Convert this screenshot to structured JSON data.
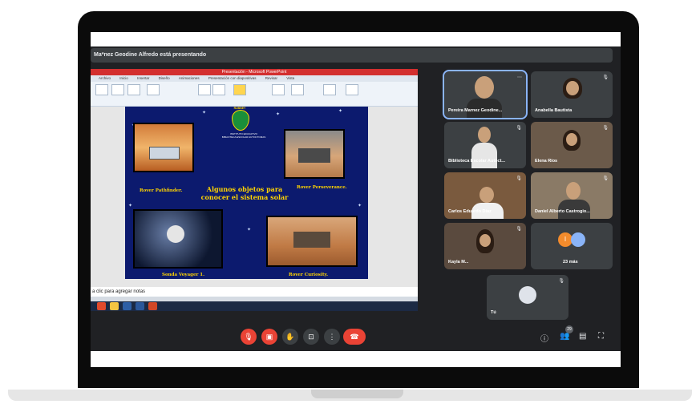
{
  "meeting": {
    "presenting_banner": "Ma*nez Geodine Alfredo está presentando"
  },
  "presentation": {
    "window_title": "Presentación - Microsoft PowerPoint",
    "ribbon_tabs": [
      "Archivo",
      "Inicio",
      "Insertar",
      "Diseño",
      "Animaciones",
      "Presentación con diapositivas",
      "Revisar",
      "Vista"
    ],
    "logo_text": "RUBBEY",
    "school_line1": "INSTITUTO EDUCATIVO",
    "school_line2": "BIBLIOTECA ESCOLAR AUTOCTOMAS",
    "caption_pathfinder": "Rover Pathfinder.",
    "caption_perseverance": "Rover Perseverance.",
    "center_line1": "Algunos objetos para",
    "center_line2": "conocer el sistema solar",
    "caption_voyager": "Sonda Voyager 1.",
    "caption_curiosity": "Rover Curiosity.",
    "notes_placeholder": "a clic para agregar notas"
  },
  "participants": [
    {
      "name": "Pereira Marnez Geodine...",
      "active": true
    },
    {
      "name": "Anabella Bautista"
    },
    {
      "name": "Biblioteca Escolar Autóct..."
    },
    {
      "name": "Elena Ríos"
    },
    {
      "name": "Carlos Eduardo Díaz"
    },
    {
      "name": "Daniel Alberto Castrogio..."
    },
    {
      "name": "Kayla M..."
    },
    {
      "name": "23 más",
      "others_initial": "I"
    },
    {
      "name": "Tú"
    }
  ],
  "controls": {
    "people_count": "29"
  },
  "colors": {
    "meet_bg": "#202124",
    "tile_bg": "#3c4043",
    "danger": "#ea4335",
    "slide_bg": "#0c1a6e",
    "slide_text": "#ffd400"
  }
}
